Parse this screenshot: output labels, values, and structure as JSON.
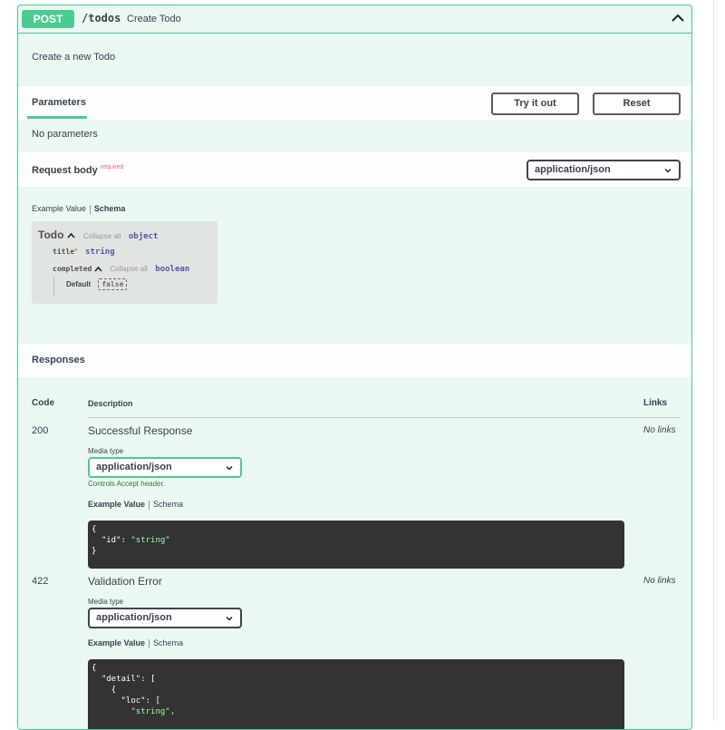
{
  "operation": {
    "method": "POST",
    "path": "/todos",
    "summary": "Create Todo",
    "description": "Create a new Todo"
  },
  "parameters": {
    "tab_label": "Parameters",
    "try_label": "Try it out",
    "reset_label": "Reset",
    "empty_text": "No parameters"
  },
  "request_body": {
    "title": "Request body",
    "required_label": "required",
    "content_type": "application/json",
    "example_tab": "Example Value",
    "schema_tab": "Schema",
    "model": {
      "name": "Todo",
      "collapse_all": "Collapse all",
      "type": "object",
      "props": [
        {
          "name": "title",
          "required": "*",
          "type": "string"
        },
        {
          "name": "completed",
          "collapse_all": "Collapse all",
          "type": "boolean",
          "default_label": "Default",
          "default_value": "false"
        }
      ]
    }
  },
  "responses": {
    "title": "Responses",
    "headers": {
      "code": "Code",
      "description": "Description",
      "links": "Links"
    },
    "items": [
      {
        "code": "200",
        "description": "Successful Response",
        "links": "No links",
        "media_label": "Media type",
        "media_type": "application/json",
        "controls_text": "Controls Accept header.",
        "example_tab": "Example Value",
        "schema_tab": "Schema",
        "example_lines": [
          "{",
          "  \"id\": \"string\"",
          "}"
        ]
      },
      {
        "code": "422",
        "description": "Validation Error",
        "links": "No links",
        "media_label": "Media type",
        "media_type": "application/json",
        "example_tab": "Example Value",
        "schema_tab": "Schema",
        "example_lines": [
          "{",
          "  \"detail\": [",
          "    {",
          "      \"loc\": [",
          "        \"string\","
        ]
      }
    ]
  },
  "colors": {
    "post": "#49cc90",
    "post_bg": "#ebf7f1",
    "code_bg": "#333333",
    "string": "#a2fca2",
    "required": "#ff6060"
  }
}
